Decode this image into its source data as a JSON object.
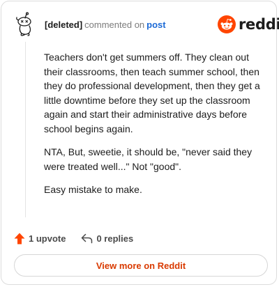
{
  "header": {
    "author": "[deleted]",
    "action": "commented on",
    "target": "post"
  },
  "brand": {
    "name": "reddit",
    "icon": "reddit-logo-icon",
    "color": "#ff4500"
  },
  "comment": {
    "paragraphs": [
      "Teachers don't get summers off. They clean out their classrooms, then teach summer school, then they do professional development, then they get a little downtime before they set up the classroom again and start their administrative days before school begins again.",
      "NTA, But, sweetie, it should be, \"never said they were treated well...\" Not \"good\".",
      "Easy mistake to make."
    ]
  },
  "actions": {
    "upvotes": "1 upvote",
    "upvote_icon": "upvote-arrow-icon",
    "replies": "0 replies",
    "reply_icon": "reply-arrow-icon"
  },
  "footer": {
    "button_label": "View more on Reddit"
  },
  "colors": {
    "link": "#1c6ad6",
    "accent": "#d93a00",
    "upvote": "#ff4500"
  }
}
